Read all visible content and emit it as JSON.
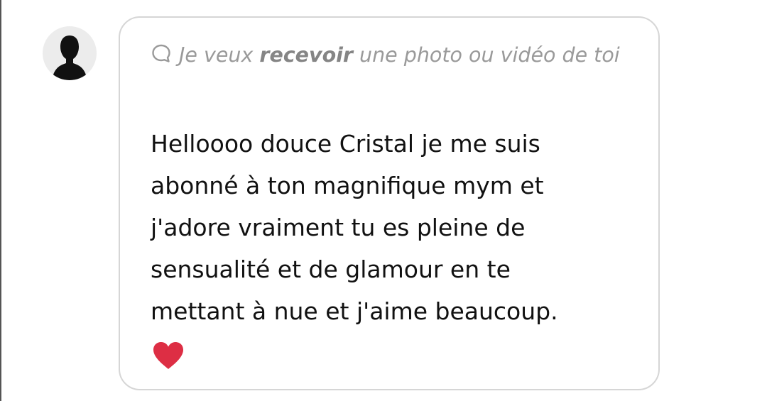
{
  "sender": {
    "avatar_icon": "default-user-silhouette-icon"
  },
  "request": {
    "icon": "speech-bubble-icon",
    "prefix": "Je veux ",
    "keyword": "recevoir",
    "suffix": " une photo ou vidéo de toi"
  },
  "message": {
    "text": "Helloooo douce Cristal je me suis\nabonné à ton magnifique mym et\nj'adore vraiment tu es pleine de\nsensualité et de glamour en te\nmettant à nue et j'aime beaucoup.",
    "emoji": "red-heart-icon"
  },
  "colors": {
    "bubble_border": "#d6d6d6",
    "request_text": "#9a9a9a",
    "message_text": "#111111",
    "heart": "#dd2e44",
    "avatar_bg": "#ececec"
  }
}
